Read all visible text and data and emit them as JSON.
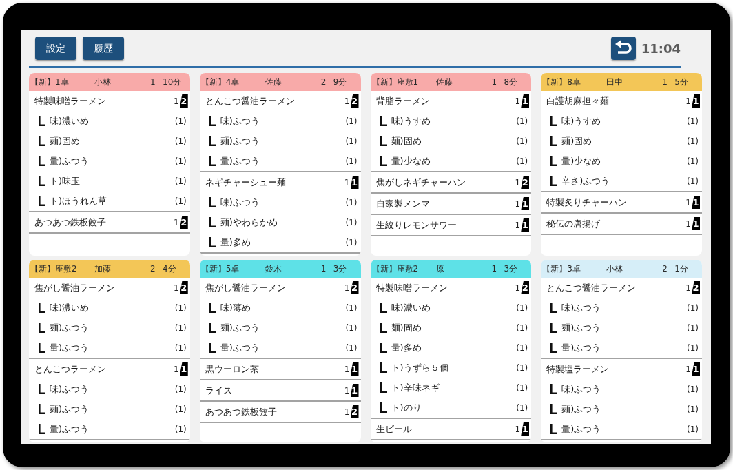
{
  "toolbar": {
    "buttons": [
      {
        "label": "設定"
      },
      {
        "label": "履歴"
      }
    ],
    "clock": "11:04"
  },
  "orders": [
    {
      "label": "【新】1卓",
      "staff": "小林",
      "guests": "1",
      "elapsed": "10分",
      "color": "#f8aaa9",
      "items": [
        {
          "name": "特製味噌ラーメン",
          "quantity": "1",
          "count": "2",
          "children": [
            {
              "name": "味)濃いめ",
              "quantity": "(1)"
            },
            {
              "name": "麺)固め",
              "quantity": "(1)"
            },
            {
              "name": "量)ふつう",
              "quantity": "(1)"
            },
            {
              "name": "ト)味玉",
              "quantity": "(1)"
            },
            {
              "name": "ト)ほうれん草",
              "quantity": "(1)"
            }
          ]
        },
        {
          "name": "あつあつ鉄板餃子",
          "quantity": "1",
          "count": "2"
        }
      ]
    },
    {
      "label": "【新】4卓",
      "staff": "佐藤",
      "guests": "2",
      "elapsed": "9分",
      "color": "#f8aaa9",
      "items": [
        {
          "name": "とんこつ醤油ラーメン",
          "quantity": "1",
          "count": "2",
          "children": [
            {
              "name": "味)ふつう",
              "quantity": "(1)"
            },
            {
              "name": "麺)ふつう",
              "quantity": "(1)"
            },
            {
              "name": "量)ふつう",
              "quantity": "(1)"
            }
          ]
        },
        {
          "name": "ネギチャーシュー麺",
          "quantity": "1",
          "count": "1",
          "children": [
            {
              "name": "味)ふつう",
              "quantity": "(1)"
            },
            {
              "name": "麺)やわらかめ",
              "quantity": "(1)"
            },
            {
              "name": "量)多め",
              "quantity": "(1)"
            }
          ]
        }
      ]
    },
    {
      "label": "【新】座敷1",
      "staff": "佐藤",
      "guests": "1",
      "elapsed": "8分",
      "color": "#f8aaa9",
      "items": [
        {
          "name": "背脂ラーメン",
          "quantity": "1",
          "count": "1",
          "children": [
            {
              "name": "味)うすめ",
              "quantity": "(1)"
            },
            {
              "name": "麺)固め",
              "quantity": "(1)"
            },
            {
              "name": "量)少なめ",
              "quantity": "(1)"
            }
          ]
        },
        {
          "name": "焦がしネギチャーハン",
          "quantity": "1",
          "count": "2"
        },
        {
          "name": "自家製メンマ",
          "quantity": "1",
          "count": "1"
        },
        {
          "name": "生絞りレモンサワー",
          "quantity": "1",
          "count": "1"
        }
      ]
    },
    {
      "label": "【新】8卓",
      "staff": "田中",
      "guests": "1",
      "elapsed": "5分",
      "color": "#f3c657",
      "items": [
        {
          "name": "白護胡麻担々麺",
          "quantity": "1",
          "count": "1",
          "children": [
            {
              "name": "味)うすめ",
              "quantity": "(1)"
            },
            {
              "name": "麺)固め",
              "quantity": "(1)"
            },
            {
              "name": "量)少なめ",
              "quantity": "(1)"
            },
            {
              "name": "辛さ)ふつう",
              "quantity": "(1)"
            }
          ]
        },
        {
          "name": "特製炙りチャーハン",
          "quantity": "1",
          "count": "1"
        },
        {
          "name": "秘伝の唐揚げ",
          "quantity": "1",
          "count": "1"
        }
      ]
    },
    {
      "label": "【新】座敷2",
      "staff": "加藤",
      "guests": "2",
      "elapsed": "4分",
      "color": "#f3c657",
      "items": [
        {
          "name": "焦がし醤油ラーメン",
          "quantity": "1",
          "count": "2",
          "children": [
            {
              "name": "味)濃いめ",
              "quantity": "(1)"
            },
            {
              "name": "麺)ふつう",
              "quantity": "(1)"
            },
            {
              "name": "量)ふつう",
              "quantity": "(1)"
            }
          ]
        },
        {
          "name": "とんこつラーメン",
          "quantity": "1",
          "count": "1",
          "children": [
            {
              "name": "味)ふつう",
              "quantity": "(1)"
            },
            {
              "name": "麺)ふつう",
              "quantity": "(1)"
            },
            {
              "name": "量)ふつう",
              "quantity": "(1)"
            }
          ]
        }
      ]
    },
    {
      "label": "【新】5卓",
      "staff": "鈴木",
      "guests": "1",
      "elapsed": "3分",
      "color": "#5ee1e7",
      "items": [
        {
          "name": "焦がし醤油ラーメン",
          "quantity": "1",
          "count": "2",
          "children": [
            {
              "name": "味)薄め",
              "quantity": "(1)"
            },
            {
              "name": "麺)ふつう",
              "quantity": "(1)"
            },
            {
              "name": "量)ふつう",
              "quantity": "(1)"
            }
          ]
        },
        {
          "name": "黒ウーロン茶",
          "quantity": "1",
          "count": "1"
        },
        {
          "name": "ライス",
          "quantity": "1",
          "count": "1"
        },
        {
          "name": "あつあつ鉄板餃子",
          "quantity": "1",
          "count": "2"
        }
      ]
    },
    {
      "label": "【新】座敷2",
      "staff": "原",
      "guests": "1",
      "elapsed": "3分",
      "color": "#5ee1e7",
      "items": [
        {
          "name": "特製味噌ラーメン",
          "quantity": "1",
          "count": "2",
          "children": [
            {
              "name": "味)濃いめ",
              "quantity": "(1)"
            },
            {
              "name": "麺)固め",
              "quantity": "(1)"
            },
            {
              "name": "量)多め",
              "quantity": "(1)"
            },
            {
              "name": "ト)うずら５個",
              "quantity": "(1)"
            },
            {
              "name": "ト)辛味ネギ",
              "quantity": "(1)"
            },
            {
              "name": "ト)のり",
              "quantity": "(1)"
            }
          ]
        },
        {
          "name": "生ビール",
          "quantity": "1",
          "count": "1"
        }
      ]
    },
    {
      "label": "【新】3卓",
      "staff": "小林",
      "guests": "2",
      "elapsed": "1分",
      "color": "#d6eef8",
      "items": [
        {
          "name": "とんこつ醤油ラーメン",
          "quantity": "1",
          "count": "2",
          "children": [
            {
              "name": "味)ふつう",
              "quantity": "(1)"
            },
            {
              "name": "麺)ふつう",
              "quantity": "(1)"
            },
            {
              "name": "量)ふつう",
              "quantity": "(1)"
            }
          ]
        },
        {
          "name": "特製塩ラーメン",
          "quantity": "1",
          "count": "1",
          "children": [
            {
              "name": "味)ふつう",
              "quantity": "(1)"
            },
            {
              "name": "麺)ふつう",
              "quantity": "(1)"
            },
            {
              "name": "量)ふつう",
              "quantity": "(1)"
            }
          ]
        }
      ]
    }
  ]
}
